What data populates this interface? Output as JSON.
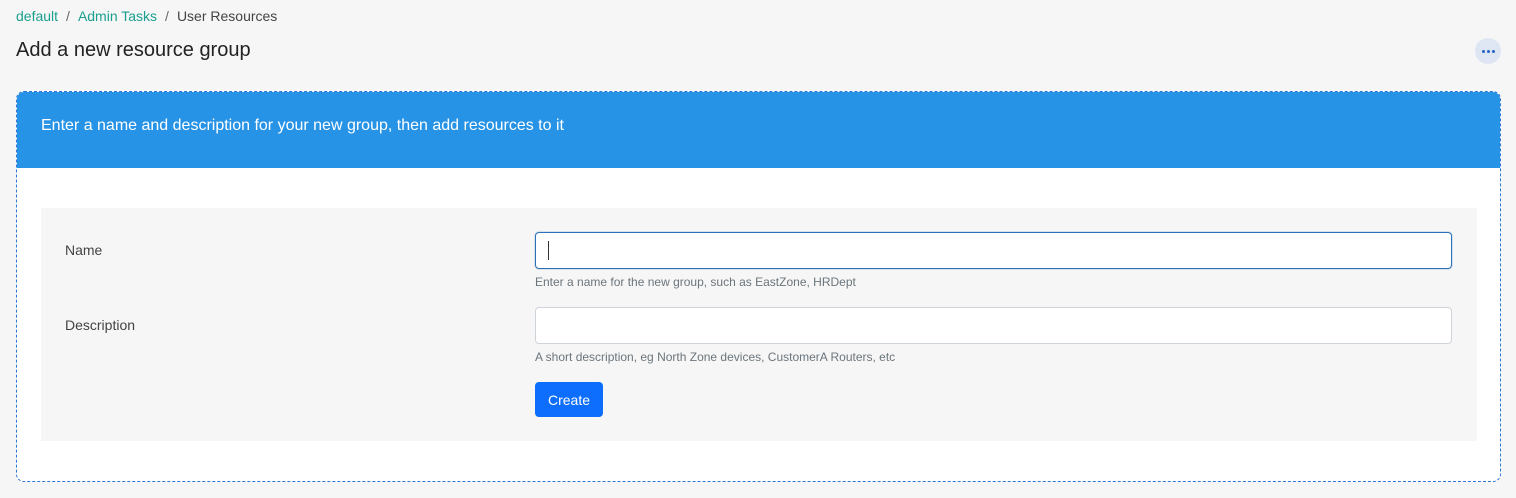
{
  "breadcrumb": {
    "items": [
      "default",
      "Admin Tasks"
    ],
    "separator": "/",
    "current": "User Resources"
  },
  "page": {
    "title": "Add a new resource group",
    "more_icon": "ellipsis-icon"
  },
  "panel": {
    "header_text": "Enter a name and description for your new group, then add resources to it",
    "header_color": "#2693e6"
  },
  "form": {
    "name_label": "Name",
    "name_value": "",
    "name_help": "Enter a name for the new group, such as EastZone, HRDept",
    "description_label": "Description",
    "description_value": "",
    "description_help": "A short description, eg North Zone devices, CustomerA Routers, etc",
    "create_label": "Create",
    "button_color": "#0d6efd"
  }
}
